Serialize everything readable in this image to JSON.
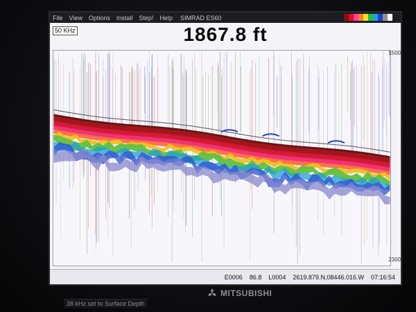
{
  "window": {
    "title": "SIMRAD ES60",
    "menu": [
      "File",
      "View",
      "Options",
      "Install",
      "Step!",
      "Help"
    ]
  },
  "readout": {
    "frequency": "50 KHz",
    "depth": "1867.8 ft",
    "scale_top": "1500",
    "scale_bottom": "2300"
  },
  "status": {
    "fields": [
      "E0006",
      "86.8",
      "L0004",
      "2619.879.N,08446.016.W",
      "07:16:54"
    ]
  },
  "osd": {
    "message": "38 kHz set to Surface Depth"
  },
  "brand": {
    "name": "MITSUBISHI"
  },
  "colors": {
    "palette": [
      "#8a1010",
      "#e01020",
      "#ff40a0",
      "#ff8020",
      "#f0e020",
      "#20c040",
      "#20a0e0",
      "#2040d0",
      "#909090",
      "#ffffff"
    ],
    "echo_bands": [
      "#5a0a0a",
      "#9a0c12",
      "#d01028",
      "#f02870",
      "#ff6a40",
      "#f0c020",
      "#60c040",
      "#20a0d0",
      "#3050d0",
      "#8888cc"
    ]
  }
}
